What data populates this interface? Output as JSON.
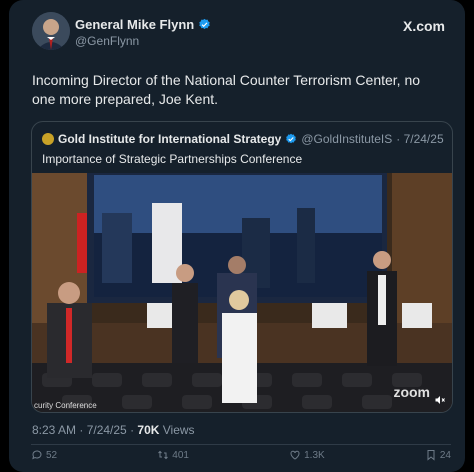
{
  "author": {
    "name": "General Mike Flynn",
    "handle": "@GenFlynn",
    "verified": true
  },
  "source_site": "X.com",
  "tweet_text": "Incoming Director of the National Counter Terrorism Center, no one more prepared, Joe Kent.",
  "quoted": {
    "name": "Gold Institute for International Strategy",
    "handle": "@GoldInstituteIS",
    "date": "· 7/24/25",
    "text": "Importance of Strategic Partnerships Conference",
    "video_caption_left": "curity Conference",
    "video_watermark": "zoom"
  },
  "meta": {
    "time": "8:23 AM · 7/24/25 · ",
    "views_count": "70K",
    "views_label": " Views"
  },
  "actions": {
    "reply": "52",
    "retweet": "401",
    "like": "1.3K",
    "bookmark": "24"
  },
  "colors": {
    "background": "#000000",
    "card": "#15202b",
    "verified": "#1d9bf0",
    "muted": "#8b98a5"
  }
}
